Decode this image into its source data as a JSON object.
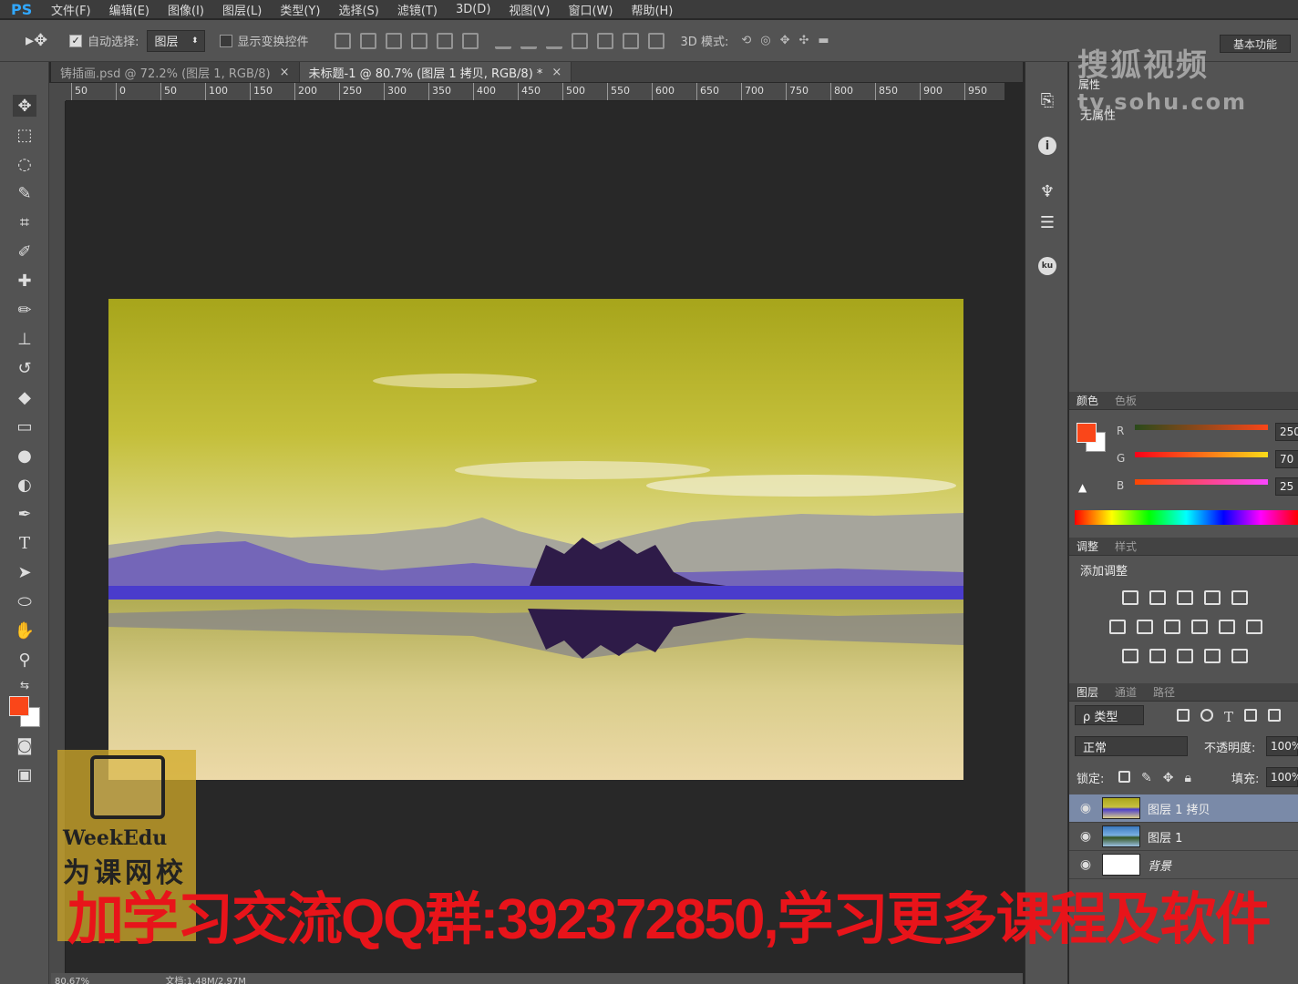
{
  "app": {
    "logo": "PS"
  },
  "menu": [
    "文件(F)",
    "编辑(E)",
    "图像(I)",
    "图层(L)",
    "类型(Y)",
    "选择(S)",
    "滤镜(T)",
    "3D(D)",
    "视图(V)",
    "窗口(W)",
    "帮助(H)"
  ],
  "options": {
    "auto_select_label": "自动选择:",
    "auto_select_value": "图层",
    "show_transform_label": "显示变换控件",
    "mode_3d_label": "3D 模式:",
    "workspace": "基本功能"
  },
  "tabs": [
    {
      "label": "铸插画.psd @ 72.2% (图层 1, RGB/8)",
      "close": "×"
    },
    {
      "label": "未标题-1 @ 80.7% (图层 1 拷贝, RGB/8) *",
      "close": "×"
    }
  ],
  "ruler_h": [
    "50",
    "0",
    "50",
    "100",
    "150",
    "200",
    "250",
    "300",
    "350",
    "400",
    "450",
    "500",
    "550",
    "600",
    "650",
    "700",
    "750",
    "800",
    "850",
    "900",
    "950"
  ],
  "properties": {
    "tab": "属性",
    "empty": "无属性"
  },
  "color_panel": {
    "tabs": [
      "颜色",
      "色板"
    ],
    "r_label": "R",
    "g_label": "G",
    "b_label": "B",
    "r": "250",
    "g": "70",
    "b": "25",
    "fg": "#fa4619"
  },
  "adjust_panel": {
    "tabs": [
      "调整",
      "样式"
    ],
    "title": "添加调整"
  },
  "layers_panel": {
    "tabs": [
      "图层",
      "通道",
      "路径"
    ],
    "filter": "ρ 类型",
    "blend": "正常",
    "opacity_label": "不透明度:",
    "opacity": "100%",
    "lock_label": "锁定:",
    "fill_label": "填充:",
    "fill": "100%",
    "layers": [
      {
        "name": "图层 1 拷贝",
        "selected": true
      },
      {
        "name": "图层 1",
        "selected": false
      },
      {
        "name": "背景",
        "selected": false
      }
    ]
  },
  "status_bar": {
    "zoom": "80.67%",
    "doc": "文档:1.48M/2.97M"
  },
  "watermarks": {
    "sohu": "搜狐视频",
    "sohu_url": "tv.sohu.com",
    "weekedu": "WeekEdu",
    "weekedu_cn": "为课网校",
    "banner": "加学习交流QQ群:392372850,学习更多课程及软件"
  }
}
